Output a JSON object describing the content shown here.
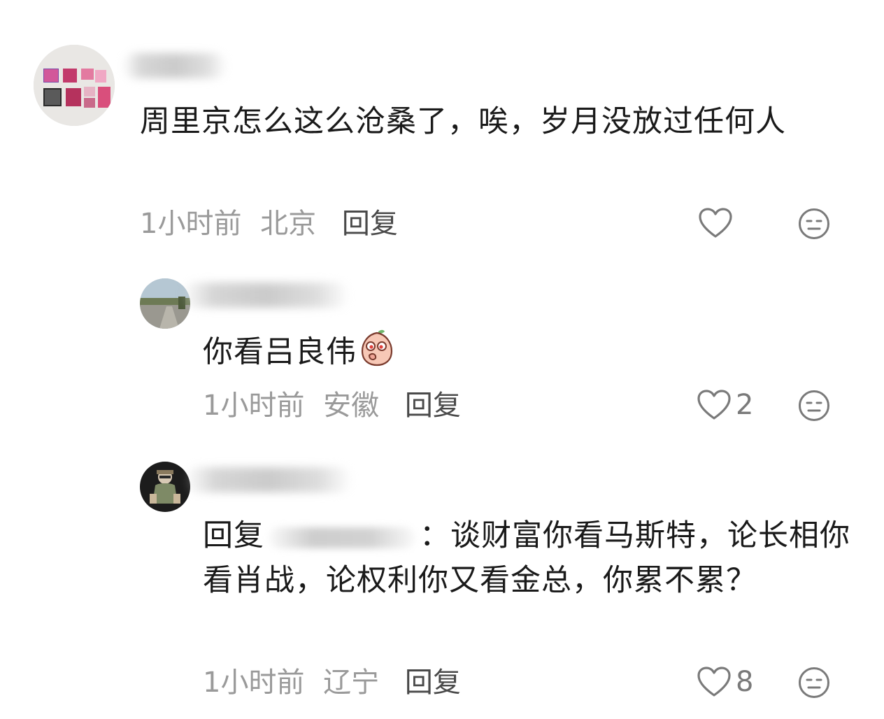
{
  "comments": [
    {
      "text": "周里京怎么这么沧桑了，唉，岁月没放过任何人",
      "time": "1小时前",
      "location": "北京",
      "reply_label": "回复",
      "likes": ""
    },
    {
      "text": "你看吕良伟",
      "time": "1小时前",
      "location": "安徽",
      "reply_label": "回复",
      "likes": "2"
    },
    {
      "reply_prefix": "回复",
      "colon": "：",
      "text": "谈财富你看马斯特，论长相你看肖战，论权利你又看金总，你累不累？",
      "time": "1小时前",
      "location": "辽宁",
      "reply_label": "回复",
      "likes": "8"
    }
  ],
  "icons": {
    "like": "heart-outline-icon",
    "dislike": "meh-face-icon",
    "emoji": "peach-emoji-icon"
  },
  "colors": {
    "text": "#1a1a1a",
    "meta": "#9a9a9a",
    "reply": "#4a4a4a",
    "icon": "#7a7a7a"
  }
}
